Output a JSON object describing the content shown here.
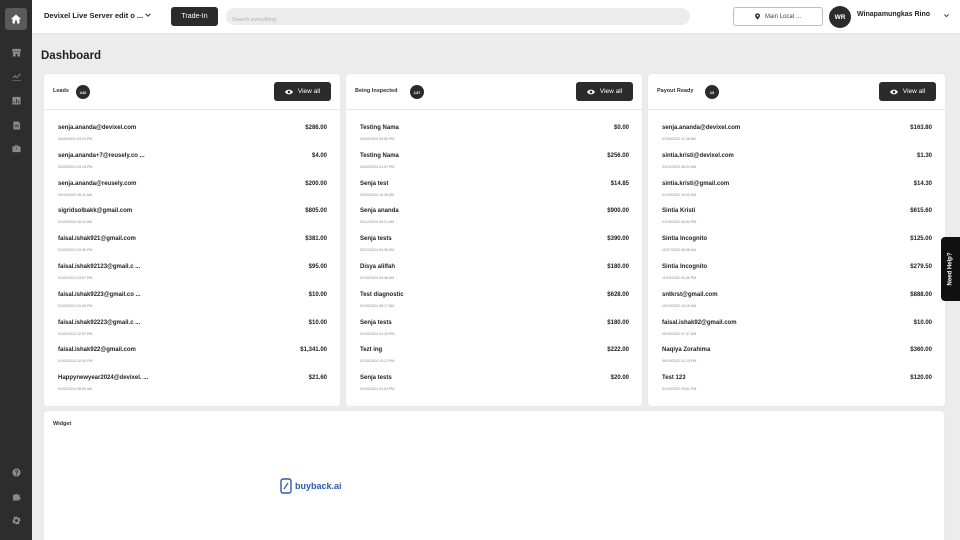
{
  "header": {
    "workspace_title": "Devixel Live Server edit o ...",
    "trade_in_label": "Trade-In",
    "search_placeholder": "Search everything",
    "location_label": "Main Locat ...",
    "user_initials": "WR",
    "user_name": "Winapamungkas Rino"
  },
  "sidebar": {
    "top_icons": [
      "home-icon",
      "store-icon",
      "chart-icon",
      "report-icon",
      "document-icon",
      "toolbox-icon"
    ],
    "bottom_icons": [
      "help-icon",
      "puzzle-icon",
      "settings-icon"
    ]
  },
  "page_title": "Dashboard",
  "view_all_label": "View all",
  "cards": [
    {
      "title": "Leads",
      "count": "242",
      "rows": [
        {
          "name": "senja.ananda@devixel.com",
          "date": "04/26/2024 04:13 PM",
          "amount": "$286.00"
        },
        {
          "name": "senja.ananda+7@reusely.co ...",
          "date": "03/26/2024 04:18 PM",
          "amount": "$4.00"
        },
        {
          "name": "senja.ananda@reusely.com",
          "date": "03/19/2024 08:11 AM",
          "amount": "$200.00"
        },
        {
          "name": "sigridsolbakk@gmail.com",
          "date": "01/23/2024 08:12 AM",
          "amount": "$805.00"
        },
        {
          "name": "faisal.ishak921@gmail.com",
          "date": "01/02/2024 03:36 PM",
          "amount": "$381.00"
        },
        {
          "name": "faisal.ishak92123@gmail.c ...",
          "date": "01/02/2024 03:07 PM",
          "amount": "$95.00"
        },
        {
          "name": "faisal.ishak9223@gmail.co ...",
          "date": "01/02/2024 01:00 PM",
          "amount": "$10.00"
        },
        {
          "name": "faisal.ishak92223@gmail.c ...",
          "date": "01/02/2024 12:57 PM",
          "amount": "$10.00"
        },
        {
          "name": "faisal.ishak922@gmail.com",
          "date": "01/02/2024 12:54 PM",
          "amount": "$1,341.00"
        },
        {
          "name": "Happynewyear2024@devixel. ...",
          "date": "01/02/2024 08:50 AM",
          "amount": "$21.60"
        }
      ]
    },
    {
      "title": "Being Inspected",
      "count": "147",
      "rows": [
        {
          "name": "Testing Nama",
          "date": "04/29/2024 05:50 PM",
          "amount": "$0.00"
        },
        {
          "name": "Testing Nama",
          "date": "04/29/2024 01:57 PM",
          "amount": "$256.00"
        },
        {
          "name": "Senja test",
          "date": "03/15/2024 10:28 AM",
          "amount": "$14.85"
        },
        {
          "name": "Senja ananda",
          "date": "03/12/2024 08:21 AM",
          "amount": "$900.00"
        },
        {
          "name": "Senja tests",
          "date": "02/21/2024 09:35 AM",
          "amount": "$390.00"
        },
        {
          "name": "Disya alilfah",
          "date": "02/19/2024 09:48 AM",
          "amount": "$180.00"
        },
        {
          "name": "Test diagnostic",
          "date": "02/16/2024 08:17 AM",
          "amount": "$628.00"
        },
        {
          "name": "Senja tests",
          "date": "02/15/2024 01:25 PM",
          "amount": "$180.00"
        },
        {
          "name": "Tezt ing",
          "date": "02/15/2024 10:12 PM",
          "amount": "$222.00"
        },
        {
          "name": "Senja tests",
          "date": "02/15/2024 01:04 PM",
          "amount": "$20.00"
        }
      ]
    },
    {
      "title": "Payout Ready",
      "count": "13",
      "rows": [
        {
          "name": "senja.ananda@devixel.com",
          "date": "07/26/2023 11:35 AM",
          "amount": "$163.80"
        },
        {
          "name": "sintia.kristi@devixel.com",
          "date": "03/10/2023 08:24 AM",
          "amount": "$1.30"
        },
        {
          "name": "sintia.kristi@gmail.com",
          "date": "01/26/2022 10:00 AM",
          "amount": "$14.30"
        },
        {
          "name": "Sintia Kristi",
          "date": "01/18/2022 04:54 PM",
          "amount": "$615.60"
        },
        {
          "name": "Sintia Incognito",
          "date": "11/07/2022 08:35 AM",
          "amount": "$125.00"
        },
        {
          "name": "Sintia Incognito",
          "date": "11/03/2022 03:36 PM",
          "amount": "$279.50"
        },
        {
          "name": "sntkrst@gmail.com",
          "date": "10/13/2022 10:19 AM",
          "amount": "$888.00"
        },
        {
          "name": "faisal.ishak92@gmail.com",
          "date": "09/18/2022 07:47 AM",
          "amount": "$10.00"
        },
        {
          "name": "Naqiya Zorahima",
          "date": "08/19/2022 01:15 PM",
          "amount": "$360.00"
        },
        {
          "name": "Test 123",
          "date": "01/24/2022 03:51 PM",
          "amount": "$120.00"
        }
      ]
    }
  ],
  "widget": {
    "title": "Widget",
    "brand": "buyback.ai"
  },
  "help_tab_label": "Need Help?",
  "colors": {
    "sidebar": "#2d2d2d",
    "dark_button": "#2b2b2b",
    "brand_blue": "#2a5cab",
    "page_background": "#ececec"
  }
}
